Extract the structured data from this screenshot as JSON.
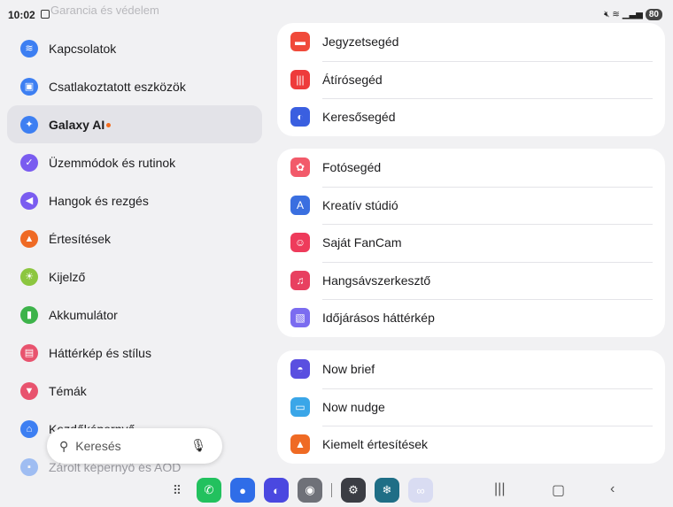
{
  "status": {
    "time": "10:02",
    "ghost_text": "Garancia és védelem",
    "icons": [
      "mute-icon",
      "wifi-icon",
      "signal-icon"
    ],
    "battery": "80"
  },
  "left_items": [
    {
      "label": "Kapcsolatok",
      "icon": "wifi-icon",
      "color": "#3d7ff2",
      "glyph": "≋"
    },
    {
      "label": "Csatlakoztatott eszközök",
      "icon": "devices-icon",
      "color": "#3d7ff2",
      "glyph": "▣"
    },
    {
      "label": "Galaxy AI",
      "icon": "galaxy-ai-icon",
      "color": "#3d7ff2",
      "glyph": "✦",
      "selected": true,
      "badge": true
    },
    {
      "label": "Üzemmódok és rutinok",
      "icon": "modes-icon",
      "color": "#7a5cf0",
      "glyph": "✓"
    },
    {
      "label": "Hangok és rezgés",
      "icon": "sound-icon",
      "color": "#7a5cf0",
      "glyph": "◀"
    },
    {
      "label": "Értesítések",
      "icon": "notification-icon",
      "color": "#ef6a24",
      "glyph": "▲"
    },
    {
      "label": "Kijelző",
      "icon": "display-icon",
      "color": "#8cc63f",
      "glyph": "☀"
    },
    {
      "label": "Akkumulátor",
      "icon": "battery-icon",
      "color": "#3db34a",
      "glyph": "▮"
    },
    {
      "label": "Háttérkép és stílus",
      "icon": "wallpaper-icon",
      "color": "#e8536e",
      "glyph": "▤"
    },
    {
      "label": "Témák",
      "icon": "themes-icon",
      "color": "#e8536e",
      "glyph": "▼"
    },
    {
      "label": "Kezdőképernyő",
      "icon": "home-icon",
      "color": "#3d7ff2",
      "glyph": "⌂"
    },
    {
      "label": "Zárolt képernyő és AOD",
      "icon": "lock-icon",
      "color": "#3d7ff2",
      "glyph": "▪",
      "faded": true
    }
  ],
  "cards": [
    {
      "rows": [
        {
          "label": "Jegyzetsegéd",
          "icon": "notes-assist-icon",
          "color": "#f04a3a",
          "glyph": "▬"
        },
        {
          "label": "Átírósegéd",
          "icon": "transcript-assist-icon",
          "color": "#ee3b3b",
          "glyph": "|||"
        },
        {
          "label": "Keresősegéd",
          "icon": "browsing-assist-icon",
          "color": "#3a5fe0",
          "glyph": "◐"
        }
      ]
    },
    {
      "rows": [
        {
          "label": "Fotósegéd",
          "icon": "photo-assist-icon",
          "color": "#f25a6a",
          "glyph": "✿"
        },
        {
          "label": "Kreatív stúdió",
          "icon": "creative-studio-icon",
          "color": "#3a6fe0",
          "glyph": "A"
        },
        {
          "label": "Saját FanCam",
          "icon": "fancam-icon",
          "color": "#ee3b5b",
          "glyph": "☺"
        },
        {
          "label": "Hangsávszerkesztő",
          "icon": "audio-eraser-icon",
          "color": "#e84060",
          "glyph": "♫"
        },
        {
          "label": "Időjárásos háttérkép",
          "icon": "weather-wallpaper-icon",
          "color": "#7b6cf0",
          "glyph": "▧"
        }
      ]
    },
    {
      "rows": [
        {
          "label": "Now brief",
          "icon": "now-brief-icon",
          "color": "#5a4fe0",
          "glyph": "◓"
        },
        {
          "label": "Now nudge",
          "icon": "now-nudge-icon",
          "color": "#3aa6e8",
          "glyph": "▭"
        },
        {
          "label": "Kiemelt értesítések",
          "icon": "highlighted-notification-icon",
          "color": "#ef6a24",
          "glyph": "▲"
        }
      ]
    }
  ],
  "search": {
    "label": "Keresés"
  },
  "taskbar": {
    "apps": [
      {
        "name": "phone-app-icon",
        "color": "#22c15e",
        "glyph": "✆"
      },
      {
        "name": "messages-app-icon",
        "color": "#2f6de8",
        "glyph": "●"
      },
      {
        "name": "internet-app-icon",
        "color": "#4a48e0",
        "glyph": "◐"
      },
      {
        "name": "camera-app-icon",
        "color": "#6f7178",
        "glyph": "◉"
      }
    ],
    "apps_right": [
      {
        "name": "settings-app-icon",
        "color": "#3b3d44",
        "glyph": "⚙"
      },
      {
        "name": "snowflake-app-icon",
        "color": "#1f6e86",
        "glyph": "❄"
      },
      {
        "name": "multiwindow-app-icon",
        "color": "#d9dcf2",
        "glyph": "∞"
      }
    ]
  }
}
